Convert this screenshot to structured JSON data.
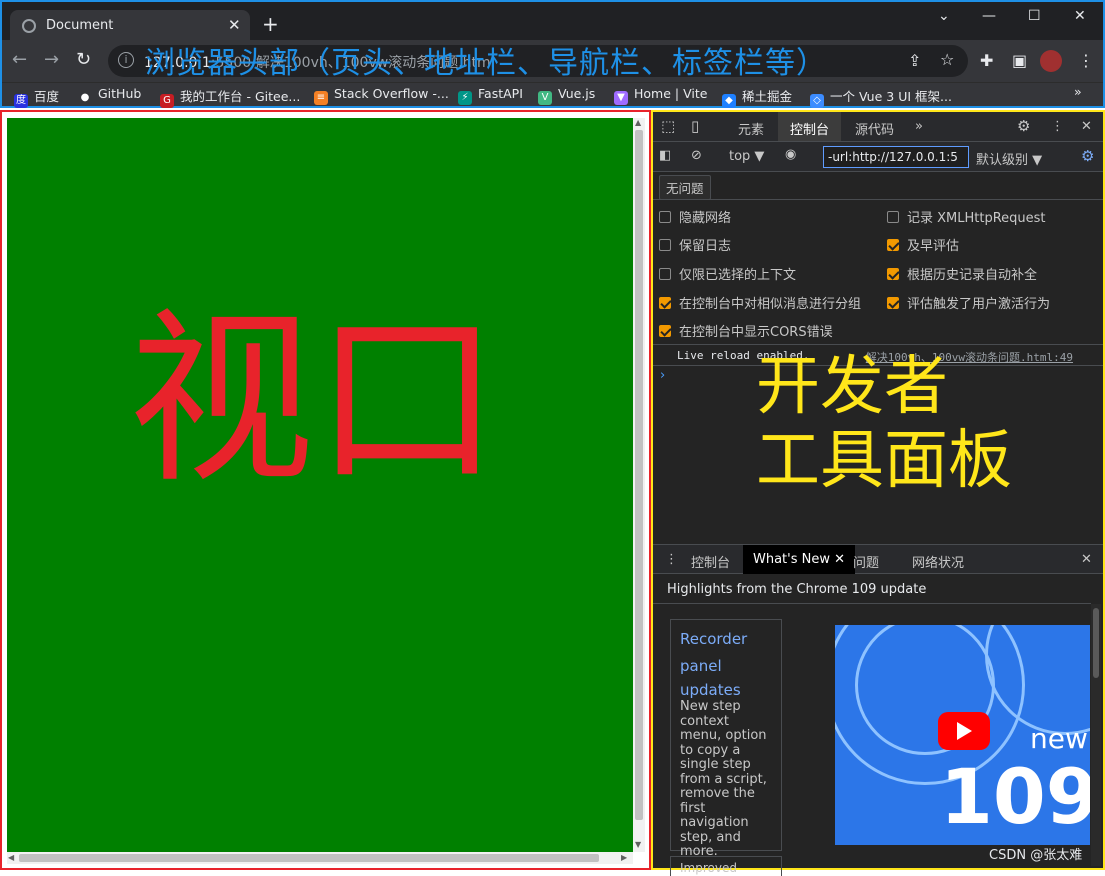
{
  "browser": {
    "tab_title": "Document",
    "tab_close": "✕",
    "new_tab": "+",
    "window_controls": {
      "chevron": "⌄",
      "minimize": "—",
      "maximize": "☐",
      "close": "✕"
    },
    "nav": {
      "back": "←",
      "forward": "→",
      "reload": "↻"
    },
    "url_host": "127.0.0.1",
    "url_path": ":5500/解决100vh、100vw滚动条问题.html",
    "bookmarks": [
      {
        "label": "百度",
        "color": "#2932e1",
        "glyph": "度"
      },
      {
        "label": "GitHub",
        "color": "#ffffff",
        "glyph": "●"
      },
      {
        "label": "我的工作台 - Gitee...",
        "color": "#c71d23",
        "glyph": "G"
      },
      {
        "label": "Stack Overflow -...",
        "color": "#f48024",
        "glyph": "≡"
      },
      {
        "label": "FastAPI",
        "color": "#009688",
        "glyph": "⚡"
      },
      {
        "label": "Vue.js",
        "color": "#41b883",
        "glyph": "V"
      },
      {
        "label": "Home | Vite",
        "color": "#9f6bff",
        "glyph": "▼"
      },
      {
        "label": "稀土掘金",
        "color": "#1e80ff",
        "glyph": "◆"
      },
      {
        "label": "一个 Vue 3 UI 框架...",
        "color": "#3c8cff",
        "glyph": "◇"
      }
    ],
    "more_bookmarks": "»"
  },
  "annotations": {
    "head_label": "浏览器头部（页头、地址栏、导航栏、标签栏等）",
    "viewport_label": "视口",
    "devtools_label_line1": "开发者",
    "devtools_label_line2": "工具面板"
  },
  "devtools": {
    "tabs": [
      "元素",
      "控制台",
      "源代码"
    ],
    "active_tab": "控制台",
    "more_tabs": "»",
    "context": "top ▼",
    "filter_value": "-url:http://127.0.0.1:5",
    "level": "默认级别 ▼",
    "issues_button": "无问题",
    "options_left": [
      {
        "label": "隐藏网络",
        "checked": false
      },
      {
        "label": "保留日志",
        "checked": false
      },
      {
        "label": "仅限已选择的上下文",
        "checked": false
      },
      {
        "label": "在控制台中对相似消息进行分组",
        "checked": true
      },
      {
        "label": "在控制台中显示CORS错误",
        "checked": true
      }
    ],
    "options_right": [
      {
        "label": "记录 XMLHttpRequest",
        "checked": false
      },
      {
        "label": "及早评估",
        "checked": true
      },
      {
        "label": "根据历史记录自动补全",
        "checked": true
      },
      {
        "label": "评估触发了用户激活行为",
        "checked": true
      }
    ],
    "log_message": "Live reload enabled.",
    "log_source": "解决100vh、100vw滚动条问题.html:49",
    "prompt": "›"
  },
  "drawer": {
    "tabs": [
      "控制台",
      "What's New",
      "问题",
      "网络状况"
    ],
    "active_tab": "What's New",
    "close": "✕",
    "highlights_title": "Highlights from the Chrome 109 update",
    "card_title_lines": [
      "Recorder",
      "panel",
      "updates"
    ],
    "card_desc": "New step context menu, option to copy a single step from a script, remove the first navigation step, and more.",
    "card2_title": "Improved",
    "promo_new": "new",
    "promo_number": "109"
  },
  "watermark": "CSDN @张太难",
  "colors": {
    "head_border": "#1e90e6",
    "viewport_border": "#e8232b",
    "devtools_border": "#ffe61a",
    "viewport_fill": "#008000"
  }
}
